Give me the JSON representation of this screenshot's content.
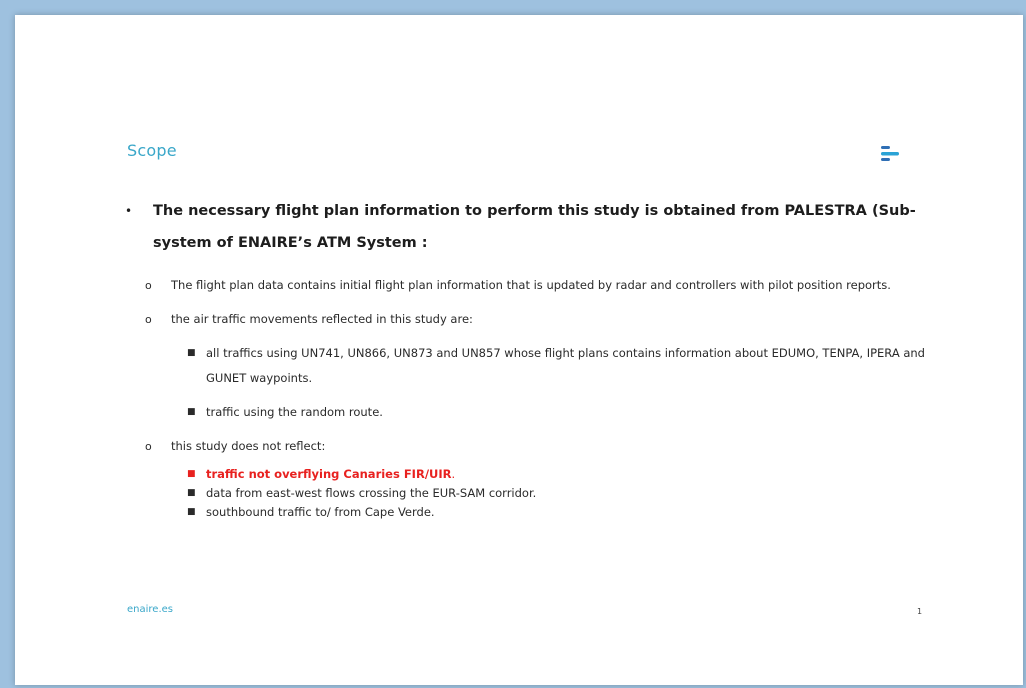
{
  "slide": {
    "title": "Scope",
    "brand_color": "#3aa7c9",
    "logo_icon": "enaire-logo-icon",
    "main_point": "The necessary flight plan information to perform this study is obtained from PALESTRA (Sub-system of ENAIRE’s ATM System :",
    "sub_points": [
      "The flight plan data contains initial flight plan information that is updated by radar and controllers with pilot position reports.",
      "the air traffic movements reflected in this study are:",
      "this study does not reflect:"
    ],
    "reflected_items": [
      "all traffics using UN741, UN866, UN873 and UN857 whose flight plans contains information about EDUMO, TENPA, IPERA and GUNET waypoints.",
      "traffic using the random route."
    ],
    "not_reflected_items": [
      "traffic not overflying Canaries FIR/UIR",
      "data from east-west flows crossing the EUR-SAM corridor.",
      "southbound traffic to/ from  Cape Verde."
    ],
    "not_reflected_first_suffix": ".",
    "highlight_color": "#e8211f",
    "footer_link": "enaire.es",
    "page_number": "1"
  }
}
